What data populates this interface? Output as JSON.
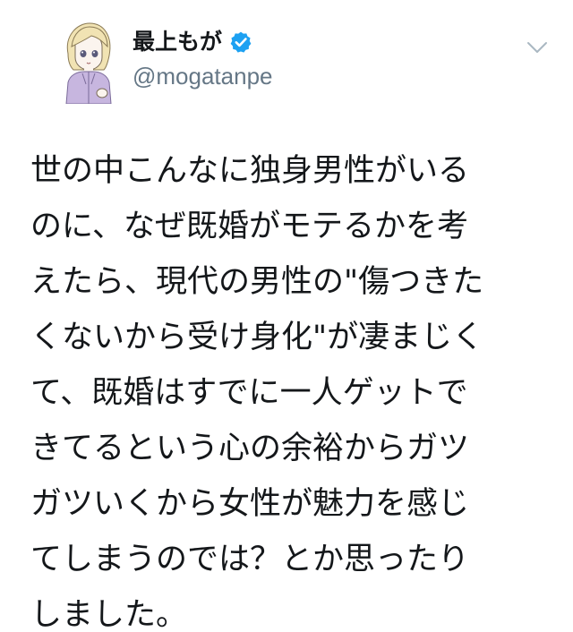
{
  "author": {
    "display_name": "最上もが",
    "handle": "@mogatanpe",
    "verified_icon": "verified-badge-icon",
    "avatar_icon": "anime-avatar-icon"
  },
  "menu_icon": "chevron-down-icon",
  "tweet": {
    "lines": [
      "世の中こんなに独身男性がいる",
      "のに、なぜ既婚がモテるかを考",
      "えたら、現代の男性の\"傷つきた",
      "くないから受け身化\"が凄まじく",
      "て、既婚はすでに一人ゲットで",
      "きてるという心の余裕からガツ",
      "ガツいくから女性が魅力を感じ",
      "てしまうのでは？とか思ったり",
      "しました。"
    ]
  },
  "colors": {
    "text": "#14171a",
    "secondary": "#657786",
    "verified": "#1da1f2"
  }
}
